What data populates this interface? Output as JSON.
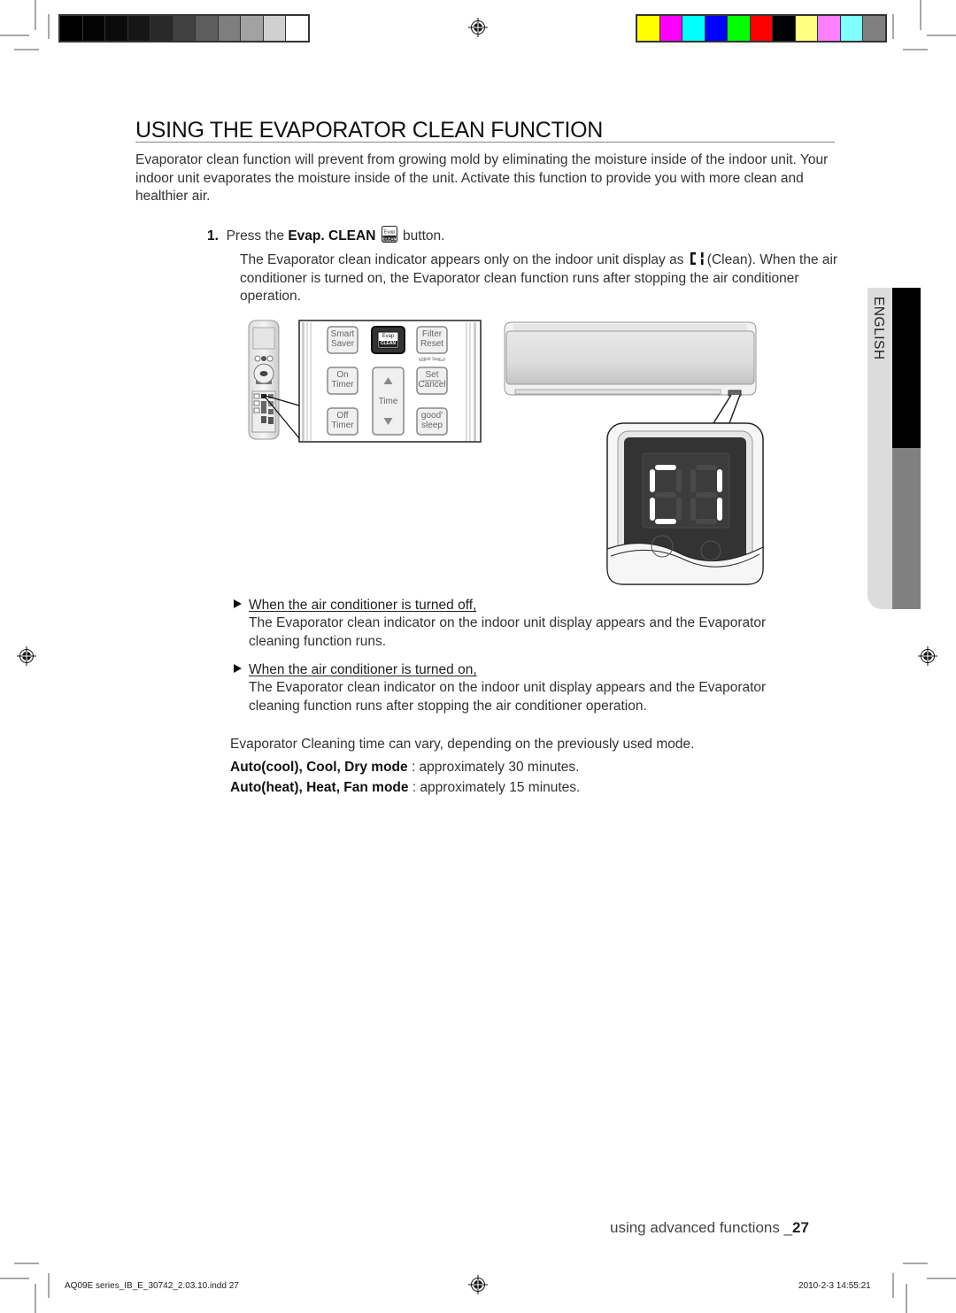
{
  "print_marks": {
    "gray_swatches": [
      "#000000",
      "#040404",
      "#0b0b0b",
      "#161616",
      "#292929",
      "#414141",
      "#5d5d5d",
      "#7e7e7e",
      "#a2a2a2",
      "#d0d0d0",
      "#ffffff"
    ],
    "color_swatches": [
      "#ffff00",
      "#ff00ff",
      "#00ffff",
      "#0000ff",
      "#00ff00",
      "#ff0000",
      "#000000",
      "#ffff80",
      "#ff80ff",
      "#80ffff",
      "#808080"
    ]
  },
  "page": {
    "title": "USING THE EVAPORATOR CLEAN FUNCTION",
    "intro": "Evaporator clean function will prevent from growing mold by eliminating the moisture inside of the indoor unit. Your indoor unit evaporates the moisture inside of the unit. Activate this function to provide you with more clean and healthier air.",
    "step1": {
      "number": "1.",
      "pre": "Press the ",
      "bold": "Evap. CLEAN",
      "post": " button.",
      "desc_pre": "The Evaporator clean indicator appears only on the indoor unit display as ",
      "desc_post": "(Clean). When the air conditioner is turned on, the Evaporator clean function runs after stopping the air conditioner operation."
    },
    "remote_buttons": {
      "smart_saver": [
        "Smart",
        "Saver"
      ],
      "evap": [
        "Evap",
        "CLEAN"
      ],
      "filter_reset": [
        "Filter",
        "Reset"
      ],
      "hold": "Hold 3sec.",
      "on_timer": [
        "On",
        "Timer"
      ],
      "time": "Time",
      "set_cancel": [
        "Set",
        "Cancel"
      ],
      "off_timer": [
        "Off",
        "Timer"
      ],
      "good_sleep": [
        "good'",
        "sleep"
      ]
    },
    "display_code": "CL",
    "bullets": [
      {
        "heading": "When the air conditioner is turned off,",
        "text": "The Evaporator clean indicator on the indoor unit display appears and the Evaporator cleaning function runs."
      },
      {
        "heading": "When the air conditioner is turned on,",
        "text": "The Evaporator clean indicator on the indoor unit display appears and the Evaporator cleaning function runs after stopping the air conditioner operation."
      }
    ],
    "timing_note": "Evaporator Cleaning time can vary, depending on the previously used mode.",
    "timings": [
      {
        "modes": "Auto(cool), Cool, Dry mode",
        "value": " : approximately 30 minutes."
      },
      {
        "modes": "Auto(heat), Heat, Fan mode",
        "value": " : approximately 15 minutes."
      }
    ],
    "language_tab": "ENGLISH",
    "footer_section": "using advanced functions _",
    "page_number": "27"
  },
  "slug": {
    "file": "AQ09E series_IB_E_30742_2.03.10.indd   27",
    "datetime": "2010-2-3   14:55:21"
  }
}
